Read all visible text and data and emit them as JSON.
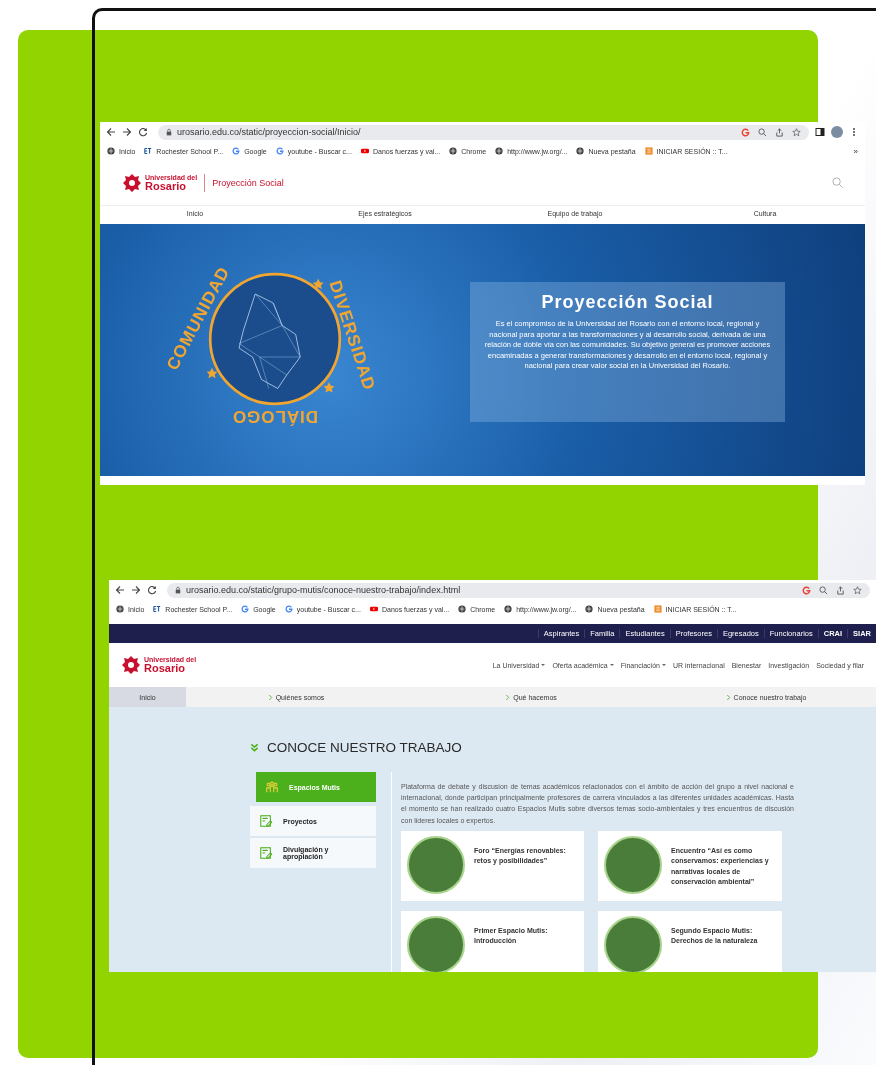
{
  "browser_top": {
    "url": "urosario.edu.co/static/proyeccion-social/Inicio/",
    "bookmarks": [
      {
        "kind": "globe",
        "label": "Inicio"
      },
      {
        "kind": "et",
        "label": "Rochester School P..."
      },
      {
        "kind": "google",
        "label": "Google"
      },
      {
        "kind": "google",
        "label": "youtube - Buscar c..."
      },
      {
        "kind": "youtube",
        "label": "Danos fuerzas y val..."
      },
      {
        "kind": "globe",
        "label": "Chrome"
      },
      {
        "kind": "globe",
        "label": "http://www.jw.org/..."
      },
      {
        "kind": "globe",
        "label": "Nueva pestaña"
      },
      {
        "kind": "orange",
        "label": "INICIAR SESIÓN :: T..."
      }
    ],
    "bookmarks_more": "»",
    "logo": {
      "small": "Universidad del",
      "large": "Rosario"
    },
    "site_title": "Proyección Social",
    "nav": [
      "Inicio",
      "Ejes estratégicos",
      "Equipo de trabajo",
      "Cultura"
    ],
    "emblem": [
      "COMUNIDAD",
      "DIVERSIDAD",
      "DIÁLOGO"
    ],
    "banner": {
      "title": "Proyección Social",
      "text": "Es el compromiso de la Universidad del Rosario con el entorno local, regional y nacional para aportar a las transformaciones y al desarrollo social, derivada de una relación de doble vía con las comunidades. Su objetivo general es promover acciones encaminadas a generar transformaciones y desarrollo en el entorno local, regional y nacional para crear valor social en la Universidad del Rosario."
    }
  },
  "browser_bottom": {
    "url": "urosario.edu.co/static/grupo-mutis/conoce-nuestro-trabajo/index.html",
    "bookmarks": [
      {
        "kind": "globe",
        "label": "Inicio"
      },
      {
        "kind": "et",
        "label": "Rochester School P..."
      },
      {
        "kind": "google",
        "label": "Google"
      },
      {
        "kind": "google",
        "label": "youtube - Buscar c..."
      },
      {
        "kind": "youtube",
        "label": "Danos fuerzas y val..."
      },
      {
        "kind": "globe",
        "label": "Chrome"
      },
      {
        "kind": "globe",
        "label": "http://www.jw.org/..."
      },
      {
        "kind": "globe",
        "label": "Nueva pestaña"
      },
      {
        "kind": "orange",
        "label": "INICIAR SESIÓN :: T..."
      }
    ],
    "audience_links": [
      {
        "label": "Aspirantes",
        "emphasized": false
      },
      {
        "label": "Familia",
        "emphasized": false
      },
      {
        "label": "Estudiantes",
        "emphasized": false
      },
      {
        "label": "Profesores",
        "emphasized": false
      },
      {
        "label": "Egresados",
        "emphasized": false
      },
      {
        "label": "Funcionarios",
        "emphasized": false
      },
      {
        "label": "CRAI",
        "emphasized": true
      },
      {
        "label": "SIAR",
        "emphasized": true
      }
    ],
    "logo": {
      "small": "Universidad del",
      "large": "Rosario"
    },
    "menu": [
      {
        "label": "La Universidad",
        "dropdown": true
      },
      {
        "label": "Oferta académica",
        "dropdown": true
      },
      {
        "label": "Financiación",
        "dropdown": true
      },
      {
        "label": "UR internacional",
        "dropdown": false
      },
      {
        "label": "Bienestar",
        "dropdown": false
      },
      {
        "label": "Investigación",
        "dropdown": false
      },
      {
        "label": "Sociedad y filar",
        "dropdown": false
      }
    ],
    "subnav": [
      {
        "label": "Inicio",
        "selected": true
      },
      {
        "label": "Quiénes somos",
        "selected": false
      },
      {
        "label": "Qué hacemos",
        "selected": false
      },
      {
        "label": "Conoce nuestro trabajo",
        "selected": false
      }
    ],
    "heading": "CONOCE NUESTRO TRABAJO",
    "side_menu": [
      {
        "kind": "people",
        "label": "Espacios Mutis",
        "selected": true
      },
      {
        "kind": "note",
        "label": "Proyectos",
        "selected": false
      },
      {
        "kind": "note",
        "label": "Divulgación y apropiación",
        "selected": false
      }
    ],
    "description": "Plataforma de debate y discusion de temas académicos relacionados con el ámbito de acción del grupo a nivel nacional e internacional, donde participan principalmente profesores de carrera vinculados a las diferentes unidades académicas. Hasta el momento se han realizado cuatro Espacios Mutis sobre diversos temas socio-ambientales y tres encuentros de discusión con lideres locales o expertos.",
    "cards": [
      {
        "title": "Foro “Energías renovables: retos y posibilidades”"
      },
      {
        "title": "Encuentro “Así es como conservamos: experiencias y narrativas locales de conservación ambiental”"
      },
      {
        "title": "Primer Espacio Mutis: Introducción"
      },
      {
        "title": "Segundo Espacio Mutis: Derechos de la naturaleza"
      }
    ]
  }
}
